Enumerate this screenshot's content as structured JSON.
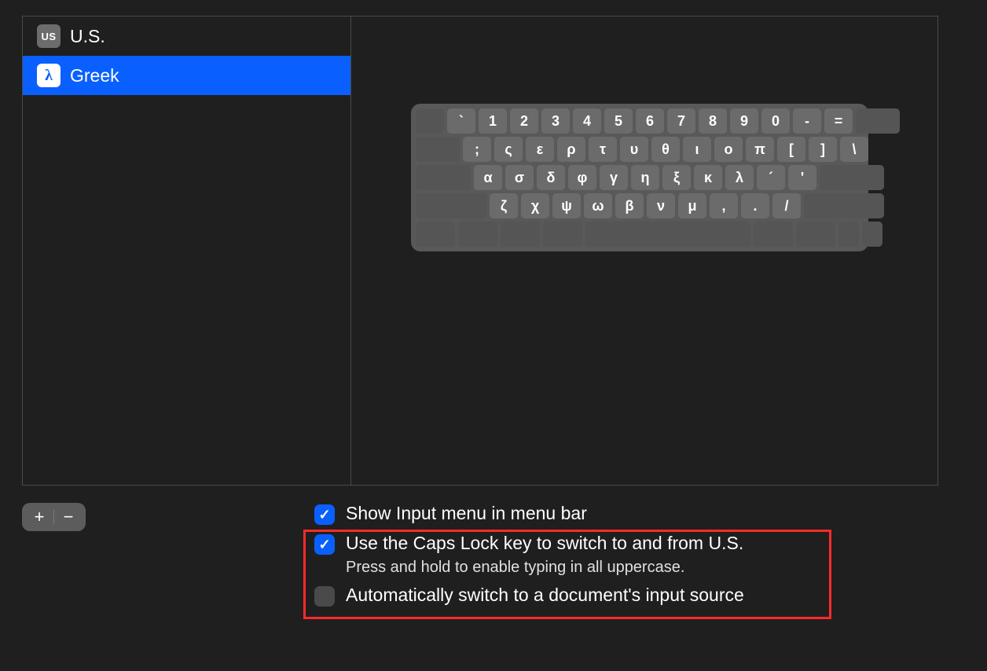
{
  "sidebar": {
    "items": [
      {
        "label": "U.S.",
        "icon_text": "US",
        "selected": false
      },
      {
        "label": "Greek",
        "icon_text": "λ",
        "selected": true
      }
    ]
  },
  "keyboard": {
    "rows": [
      {
        "keys": [
          "`",
          "1",
          "2",
          "3",
          "4",
          "5",
          "6",
          "7",
          "8",
          "9",
          "0",
          "-",
          "="
        ],
        "lead_blank": true,
        "trail_blank": "wBig"
      },
      {
        "keys": [
          ";",
          "ς",
          "ε",
          "ρ",
          "τ",
          "υ",
          "θ",
          "ι",
          "ο",
          "π",
          "[",
          "]",
          "\\"
        ],
        "lead_blank": "wTabL"
      },
      {
        "keys": [
          "α",
          "σ",
          "δ",
          "φ",
          "γ",
          "η",
          "ξ",
          "κ",
          "λ",
          "´",
          "'"
        ],
        "lead_blank": "wCapsL",
        "trail_blank": "wCapsR"
      },
      {
        "keys": [
          "ζ",
          "χ",
          "ψ",
          "ω",
          "β",
          "ν",
          "μ",
          ",",
          ".",
          "/"
        ],
        "lead_blank": "wShiftL",
        "trail_blank": "wShiftR"
      }
    ]
  },
  "addremove": {
    "plus": "+",
    "minus": "−"
  },
  "options": [
    {
      "label": "Show Input menu in menu bar",
      "sub": null,
      "checked": true
    },
    {
      "label": "Use the Caps Lock key to switch to and from U.S.",
      "sub": "Press and hold to enable typing in all uppercase.",
      "checked": true
    },
    {
      "label": "Automatically switch to a document's input source",
      "sub": null,
      "checked": false
    }
  ]
}
